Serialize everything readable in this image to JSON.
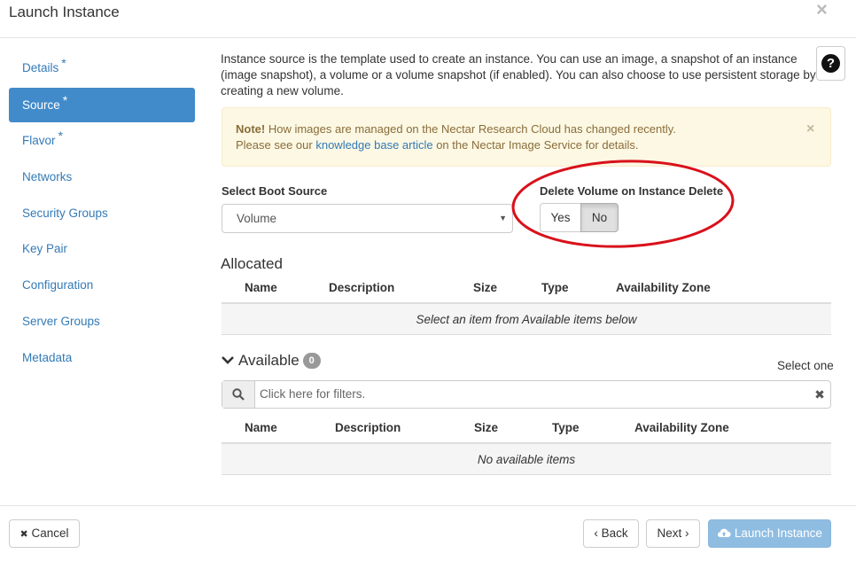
{
  "modal": {
    "title": "Launch Instance",
    "close_glyph": "×"
  },
  "sidebar": {
    "items": [
      {
        "label": "Details",
        "required": true,
        "active": false
      },
      {
        "label": "Source",
        "required": true,
        "active": true
      },
      {
        "label": "Flavor",
        "required": true,
        "active": false
      },
      {
        "label": "Networks",
        "required": false,
        "active": false
      },
      {
        "label": "Security Groups",
        "required": false,
        "active": false
      },
      {
        "label": "Key Pair",
        "required": false,
        "active": false
      },
      {
        "label": "Configuration",
        "required": false,
        "active": false
      },
      {
        "label": "Server Groups",
        "required": false,
        "active": false
      },
      {
        "label": "Metadata",
        "required": false,
        "active": false
      }
    ],
    "required_marker": "*"
  },
  "source": {
    "description": "Instance source is the template used to create an instance. You can use an image, a snapshot of an instance (image snapshot), a volume or a volume snapshot (if enabled). You can also choose to use persistent storage by creating a new volume.",
    "help_icon_glyph": "?",
    "alert": {
      "strong": "Note!",
      "text1": " How images are managed on the Nectar Research Cloud has changed recently.",
      "text2": "Please see our ",
      "link": "knowledge base article",
      "text3": " on the Nectar Image Service for details.",
      "close_glyph": "×"
    },
    "boot_source": {
      "label": "Select Boot Source",
      "value": "Volume",
      "caret": "▼"
    },
    "delete_volume": {
      "label": "Delete Volume on Instance Delete",
      "yes": "Yes",
      "no": "No",
      "selected": "No"
    }
  },
  "allocated": {
    "title": "Allocated",
    "columns": [
      "Name",
      "Description",
      "Size",
      "Type",
      "Availability Zone"
    ],
    "empty_text": "Select an item from Available items below"
  },
  "available": {
    "title": "Available",
    "count": "0",
    "chevron_glyph": "⌄",
    "select_hint": "Select one",
    "filter_placeholder": "Click here for filters.",
    "clear_glyph": "✖",
    "columns": [
      "Name",
      "Description",
      "Size",
      "Type",
      "Availability Zone"
    ],
    "empty_text": "No available items"
  },
  "footer": {
    "cancel": "Cancel",
    "cancel_glyph": "✖",
    "back": "Back",
    "back_glyph": "‹",
    "next": "Next",
    "next_glyph": "›",
    "launch": "Launch Instance"
  },
  "colors": {
    "active_nav": "#428bca",
    "link": "#337ab7",
    "alert_bg": "#fcf8e3",
    "annotation": "#d9111b",
    "primary_btn": "#8fbde2"
  }
}
